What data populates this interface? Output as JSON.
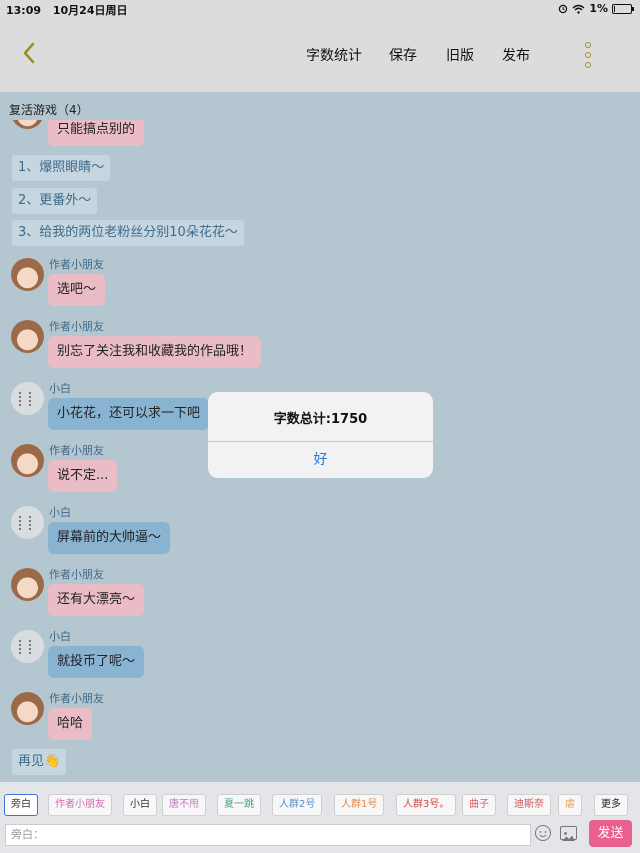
{
  "status_bar": {
    "time": "13:09",
    "date": "10月24日周日",
    "battery": "1%",
    "battery_level": 0.01
  },
  "nav": {
    "items": [
      "字数统计",
      "保存",
      "旧版",
      "发布"
    ]
  },
  "chat_title": "复活游戏（4）",
  "messages": [
    {
      "type": "author",
      "text": "只能搞点别的"
    },
    {
      "type": "narration",
      "text": "1、爆照眼睛～"
    },
    {
      "type": "narration",
      "text": "2、更番外～"
    },
    {
      "type": "narration",
      "text": "3、给我的两位老粉丝分别10朵花花～"
    },
    {
      "type": "author",
      "name": "作者小朋友",
      "text": "选吧～"
    },
    {
      "type": "author",
      "name": "作者小朋友",
      "text": "别忘了关注我和收藏我的作品哦！"
    },
    {
      "type": "xiaobai",
      "name": "小白",
      "text": "小花花，还可以求一下吧"
    },
    {
      "type": "author",
      "name": "作者小朋友",
      "text": "说不定..."
    },
    {
      "type": "xiaobai",
      "name": "小白",
      "text": "屏幕前的大帅逼～"
    },
    {
      "type": "author",
      "name": "作者小朋友",
      "text": "还有大漂亮～"
    },
    {
      "type": "xiaobai",
      "name": "小白",
      "text": "就投币了呢～"
    },
    {
      "type": "author",
      "name": "作者小朋友",
      "text": "哈哈"
    },
    {
      "type": "narration",
      "text": "再见👋"
    }
  ],
  "dialog": {
    "title": "字数总计:1750",
    "button": "好"
  },
  "bottom": {
    "tags": [
      {
        "label": "旁白",
        "color": "#333333",
        "active": true
      },
      {
        "label": "作者小朋友",
        "color": "#d46aa8"
      },
      {
        "label": "小白",
        "color": "#333333"
      },
      {
        "label": "唐不甩",
        "color": "#c27bc6"
      },
      {
        "label": "夏一跳",
        "color": "#4a9e8e"
      },
      {
        "label": "人群2号",
        "color": "#5a8fc6"
      },
      {
        "label": "人群1号",
        "color": "#e08a4a"
      },
      {
        "label": "人群3号。",
        "color": "#d04a4a"
      },
      {
        "label": "曲子",
        "color": "#e05a5a"
      },
      {
        "label": "迪斯奈",
        "color": "#c4565a"
      },
      {
        "label": "虐",
        "color": "#e59a5a"
      },
      {
        "label": "更多",
        "color": "#222222"
      }
    ],
    "input_placeholder": "旁白：",
    "send_label": "发送"
  }
}
